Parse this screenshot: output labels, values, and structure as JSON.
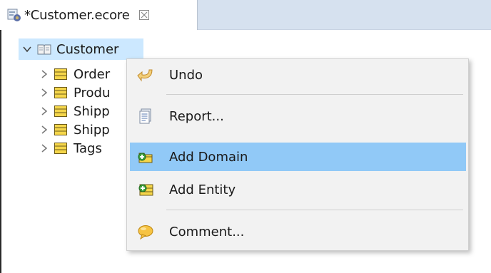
{
  "tab": {
    "label": "*Customer.ecore",
    "close_glyph": "⊠"
  },
  "tree": {
    "root": {
      "label": "Customer",
      "icon": "package-icon",
      "expanded": true
    },
    "children": [
      {
        "label": "Order",
        "icon": "eclass-icon"
      },
      {
        "label": "Produ",
        "icon": "eclass-icon"
      },
      {
        "label": "Shipp",
        "icon": "eclass-icon"
      },
      {
        "label": "Shipp",
        "icon": "eclass-icon"
      },
      {
        "label": "Tags",
        "icon": "eclass-icon"
      }
    ]
  },
  "context_menu": {
    "items": [
      {
        "label": "Undo",
        "icon": "undo-icon"
      },
      {
        "label": "Report...",
        "icon": "report-icon"
      },
      {
        "label": "Add Domain",
        "icon": "add-domain-icon",
        "highlighted": true
      },
      {
        "label": "Add Entity",
        "icon": "add-entity-icon"
      },
      {
        "label": "Comment...",
        "icon": "comment-icon"
      }
    ]
  },
  "colors": {
    "selection": "#cce8ff",
    "menu_highlight": "#91c9f7",
    "tab_bar": "#d6e1ef",
    "class_icon_yellow": "#f5d64a"
  }
}
